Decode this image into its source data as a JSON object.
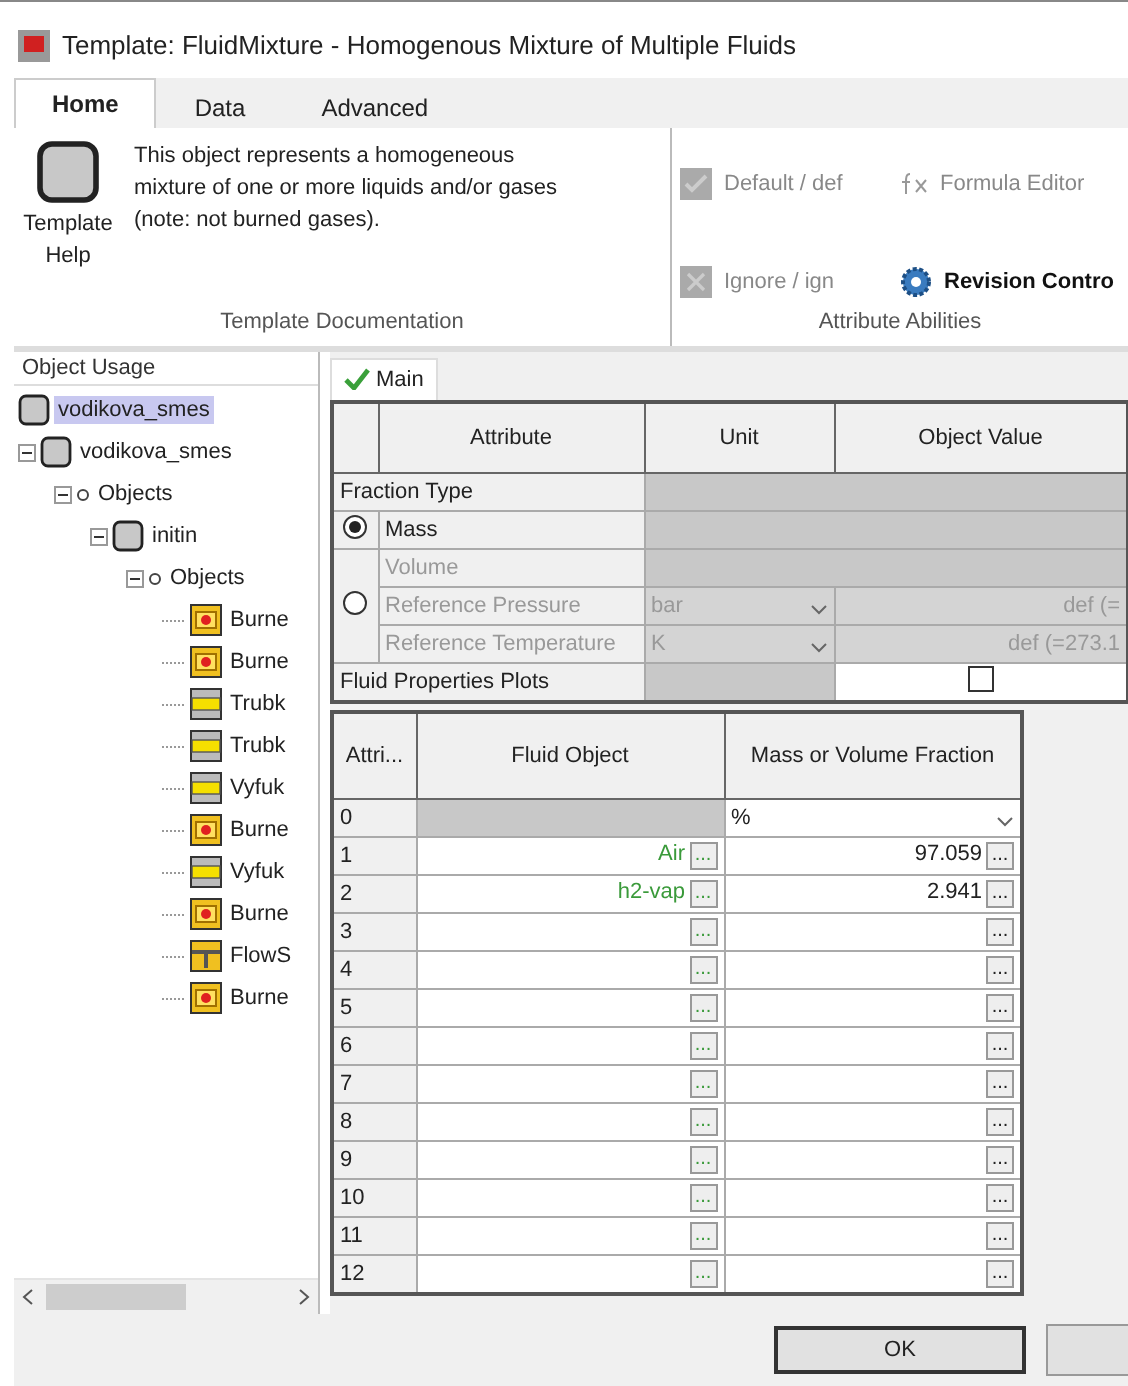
{
  "window": {
    "title": "Template: FluidMixture - Homogenous Mixture of Multiple Fluids"
  },
  "ribbon": {
    "tabs": [
      {
        "label": "Home",
        "selected": true
      },
      {
        "label": "Data",
        "selected": false
      },
      {
        "label": "Advanced",
        "selected": false
      }
    ],
    "help_button": "Template Help",
    "description": "This object represents a homogeneous mixture of one or more liquids and/or gases (note: not burned gases).",
    "documentation_group": "Template Documentation",
    "abilities": [
      {
        "kind": "checkbox",
        "label": "Default / def",
        "disabled": true
      },
      {
        "kind": "formula",
        "label": "Formula Editor",
        "disabled": true
      },
      {
        "kind": "ignore",
        "label": "Ignore / ign",
        "disabled": true
      },
      {
        "kind": "gear",
        "label": "Revision Contro",
        "disabled": false
      }
    ],
    "abilities_group": "Attribute Abilities"
  },
  "object_usage": {
    "title": "Object Usage",
    "tree": [
      {
        "label": "vodikova_smes",
        "kind": "object",
        "selected": true
      },
      {
        "label": "vodikova_smes",
        "kind": "object",
        "selected": false,
        "expanded": true,
        "children": [
          {
            "label": "Objects",
            "kind": "folder",
            "selected": false,
            "expanded": true,
            "children": [
              {
                "label": "initin",
                "kind": "object",
                "selected": false,
                "expanded": true,
                "children": [
                  {
                    "label": "Objects",
                    "kind": "folder",
                    "selected": false,
                    "expanded": true,
                    "children": [
                      {
                        "label": "Burne",
                        "kind": "burner",
                        "selected": false
                      },
                      {
                        "label": "Burne",
                        "kind": "burner",
                        "selected": false
                      },
                      {
                        "label": "Trubk",
                        "kind": "pipe",
                        "selected": false
                      },
                      {
                        "label": "Trubk",
                        "kind": "pipe",
                        "selected": false
                      },
                      {
                        "label": "Vyfuk",
                        "kind": "pipe",
                        "selected": false
                      },
                      {
                        "label": "Burne",
                        "kind": "burner",
                        "selected": false
                      },
                      {
                        "label": "Vyfuk",
                        "kind": "pipe",
                        "selected": false
                      },
                      {
                        "label": "Burne",
                        "kind": "burner",
                        "selected": false
                      },
                      {
                        "label": "FlowS",
                        "kind": "flow",
                        "selected": false
                      },
                      {
                        "label": "Burne",
                        "kind": "burner",
                        "selected": false
                      }
                    ]
                  }
                ]
              }
            ]
          }
        ]
      }
    ]
  },
  "main_tab": {
    "label": "Main",
    "selected": true
  },
  "attributes": {
    "columns": [
      "Attribute",
      "Unit",
      "Object Value"
    ],
    "section": "Fraction Type",
    "radio_groups": [
      {
        "selected": true,
        "rows": [
          {
            "attribute": "Mass",
            "disabled": false
          }
        ]
      },
      {
        "selected": false,
        "rows": [
          {
            "attribute": "Volume",
            "disabled": true
          },
          {
            "attribute": "Reference Pressure",
            "unit": "bar",
            "value": "def (=",
            "disabled": true
          },
          {
            "attribute": "Reference Temperature",
            "unit": "K",
            "value": "def (=273.1",
            "disabled": true
          }
        ]
      }
    ],
    "plots": {
      "label": "Fluid Properties Plots",
      "checked": false
    }
  },
  "fluids": {
    "columns": [
      "Attri...",
      "Fluid Object",
      "Mass or Volume Fraction"
    ],
    "rows": [
      {
        "kind": "unit",
        "index": "0",
        "fraction": "%"
      },
      {
        "kind": "entry",
        "index": "1",
        "fluid": "Air",
        "fluid_button": "...",
        "fraction": "97.059",
        "fraction_button": "..."
      },
      {
        "kind": "entry",
        "index": "2",
        "fluid": "h2-vap",
        "fluid_button": "...",
        "fraction": "2.941",
        "fraction_button": "..."
      },
      {
        "kind": "entry",
        "index": "3",
        "fluid_button": "...",
        "fraction_button": "..."
      },
      {
        "kind": "entry",
        "index": "4",
        "fluid_button": "...",
        "fraction_button": "..."
      },
      {
        "kind": "entry",
        "index": "5",
        "fluid_button": "...",
        "fraction_button": "..."
      },
      {
        "kind": "entry",
        "index": "6",
        "fluid_button": "...",
        "fraction_button": "..."
      },
      {
        "kind": "entry",
        "index": "7",
        "fluid_button": "...",
        "fraction_button": "..."
      },
      {
        "kind": "entry",
        "index": "8",
        "fluid_button": "...",
        "fraction_button": "..."
      },
      {
        "kind": "entry",
        "index": "9",
        "fluid_button": "...",
        "fraction_button": "..."
      },
      {
        "kind": "entry",
        "index": "10",
        "fluid_button": "...",
        "fraction_button": "..."
      },
      {
        "kind": "entry",
        "index": "11",
        "fluid_button": "...",
        "fraction_button": "..."
      },
      {
        "kind": "entry",
        "index": "12",
        "fluid_button": "...",
        "fraction_button": "..."
      }
    ]
  },
  "buttons": [
    "OK"
  ]
}
